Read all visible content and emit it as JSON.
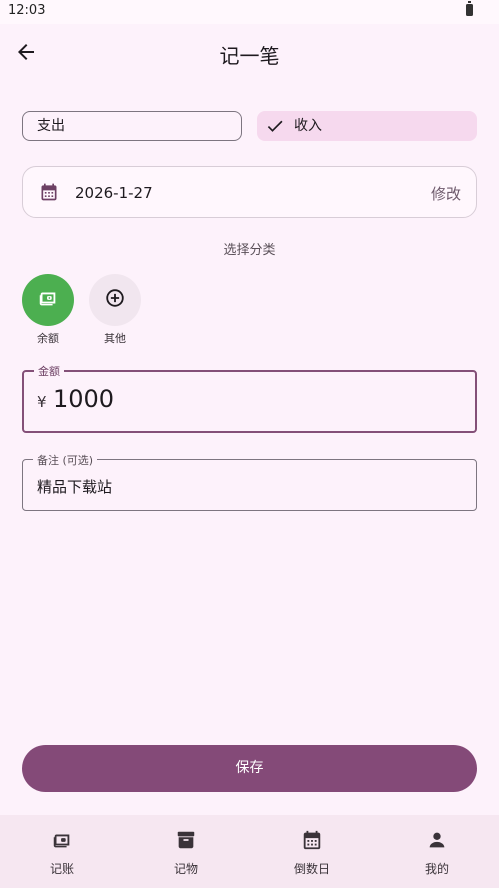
{
  "status_bar": {
    "time": "12:03"
  },
  "header": {
    "title": "记一笔",
    "back_icon": "arrow-left-icon"
  },
  "type_toggle": {
    "expense_label": "支出",
    "income_label": "收入",
    "selected": "income"
  },
  "date": {
    "value": "2026-1-27",
    "edit_label": "修改",
    "icon": "calendar-icon"
  },
  "category": {
    "caption": "选择分类",
    "items": [
      {
        "label": "余额",
        "icon": "wallet-icon",
        "color": "#4caf50",
        "selected": true
      },
      {
        "label": "其他",
        "icon": "add-circle-icon",
        "color": "#f1e6ef",
        "selected": false
      }
    ]
  },
  "amount": {
    "label": "金额",
    "currency": "¥",
    "value": "1000"
  },
  "note": {
    "label": "备注 (可选)",
    "value": "精品下载站"
  },
  "save_label": "保存",
  "bottom_nav": {
    "items": [
      {
        "label": "记账",
        "icon": "wallet-icon"
      },
      {
        "label": "记物",
        "icon": "archive-box-icon"
      },
      {
        "label": "倒数日",
        "icon": "calendar-icon"
      },
      {
        "label": "我的",
        "icon": "person-icon"
      }
    ]
  },
  "colors": {
    "background": "#fdf2fb",
    "primary": "#844a78",
    "accent_green": "#4caf50",
    "selected_chip": "#f6d9ee"
  }
}
